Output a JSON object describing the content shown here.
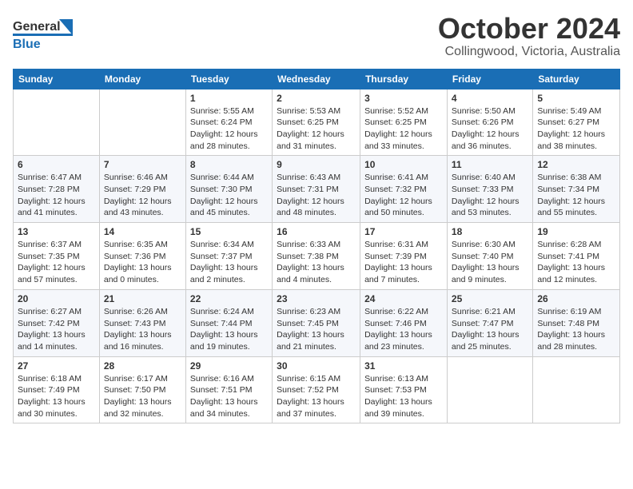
{
  "header": {
    "logo_general": "General",
    "logo_blue": "Blue",
    "month": "October 2024",
    "location": "Collingwood, Victoria, Australia"
  },
  "weekdays": [
    "Sunday",
    "Monday",
    "Tuesday",
    "Wednesday",
    "Thursday",
    "Friday",
    "Saturday"
  ],
  "weeks": [
    [
      null,
      null,
      {
        "day": 1,
        "sunrise": "5:55 AM",
        "sunset": "6:24 PM",
        "daylight": "12 hours and 28 minutes."
      },
      {
        "day": 2,
        "sunrise": "5:53 AM",
        "sunset": "6:25 PM",
        "daylight": "12 hours and 31 minutes."
      },
      {
        "day": 3,
        "sunrise": "5:52 AM",
        "sunset": "6:25 PM",
        "daylight": "12 hours and 33 minutes."
      },
      {
        "day": 4,
        "sunrise": "5:50 AM",
        "sunset": "6:26 PM",
        "daylight": "12 hours and 36 minutes."
      },
      {
        "day": 5,
        "sunrise": "5:49 AM",
        "sunset": "6:27 PM",
        "daylight": "12 hours and 38 minutes."
      }
    ],
    [
      {
        "day": 6,
        "sunrise": "6:47 AM",
        "sunset": "7:28 PM",
        "daylight": "12 hours and 41 minutes."
      },
      {
        "day": 7,
        "sunrise": "6:46 AM",
        "sunset": "7:29 PM",
        "daylight": "12 hours and 43 minutes."
      },
      {
        "day": 8,
        "sunrise": "6:44 AM",
        "sunset": "7:30 PM",
        "daylight": "12 hours and 45 minutes."
      },
      {
        "day": 9,
        "sunrise": "6:43 AM",
        "sunset": "7:31 PM",
        "daylight": "12 hours and 48 minutes."
      },
      {
        "day": 10,
        "sunrise": "6:41 AM",
        "sunset": "7:32 PM",
        "daylight": "12 hours and 50 minutes."
      },
      {
        "day": 11,
        "sunrise": "6:40 AM",
        "sunset": "7:33 PM",
        "daylight": "12 hours and 53 minutes."
      },
      {
        "day": 12,
        "sunrise": "6:38 AM",
        "sunset": "7:34 PM",
        "daylight": "12 hours and 55 minutes."
      }
    ],
    [
      {
        "day": 13,
        "sunrise": "6:37 AM",
        "sunset": "7:35 PM",
        "daylight": "12 hours and 57 minutes."
      },
      {
        "day": 14,
        "sunrise": "6:35 AM",
        "sunset": "7:36 PM",
        "daylight": "13 hours and 0 minutes."
      },
      {
        "day": 15,
        "sunrise": "6:34 AM",
        "sunset": "7:37 PM",
        "daylight": "13 hours and 2 minutes."
      },
      {
        "day": 16,
        "sunrise": "6:33 AM",
        "sunset": "7:38 PM",
        "daylight": "13 hours and 4 minutes."
      },
      {
        "day": 17,
        "sunrise": "6:31 AM",
        "sunset": "7:39 PM",
        "daylight": "13 hours and 7 minutes."
      },
      {
        "day": 18,
        "sunrise": "6:30 AM",
        "sunset": "7:40 PM",
        "daylight": "13 hours and 9 minutes."
      },
      {
        "day": 19,
        "sunrise": "6:28 AM",
        "sunset": "7:41 PM",
        "daylight": "13 hours and 12 minutes."
      }
    ],
    [
      {
        "day": 20,
        "sunrise": "6:27 AM",
        "sunset": "7:42 PM",
        "daylight": "13 hours and 14 minutes."
      },
      {
        "day": 21,
        "sunrise": "6:26 AM",
        "sunset": "7:43 PM",
        "daylight": "13 hours and 16 minutes."
      },
      {
        "day": 22,
        "sunrise": "6:24 AM",
        "sunset": "7:44 PM",
        "daylight": "13 hours and 19 minutes."
      },
      {
        "day": 23,
        "sunrise": "6:23 AM",
        "sunset": "7:45 PM",
        "daylight": "13 hours and 21 minutes."
      },
      {
        "day": 24,
        "sunrise": "6:22 AM",
        "sunset": "7:46 PM",
        "daylight": "13 hours and 23 minutes."
      },
      {
        "day": 25,
        "sunrise": "6:21 AM",
        "sunset": "7:47 PM",
        "daylight": "13 hours and 25 minutes."
      },
      {
        "day": 26,
        "sunrise": "6:19 AM",
        "sunset": "7:48 PM",
        "daylight": "13 hours and 28 minutes."
      }
    ],
    [
      {
        "day": 27,
        "sunrise": "6:18 AM",
        "sunset": "7:49 PM",
        "daylight": "13 hours and 30 minutes."
      },
      {
        "day": 28,
        "sunrise": "6:17 AM",
        "sunset": "7:50 PM",
        "daylight": "13 hours and 32 minutes."
      },
      {
        "day": 29,
        "sunrise": "6:16 AM",
        "sunset": "7:51 PM",
        "daylight": "13 hours and 34 minutes."
      },
      {
        "day": 30,
        "sunrise": "6:15 AM",
        "sunset": "7:52 PM",
        "daylight": "13 hours and 37 minutes."
      },
      {
        "day": 31,
        "sunrise": "6:13 AM",
        "sunset": "7:53 PM",
        "daylight": "13 hours and 39 minutes."
      },
      null,
      null
    ]
  ]
}
